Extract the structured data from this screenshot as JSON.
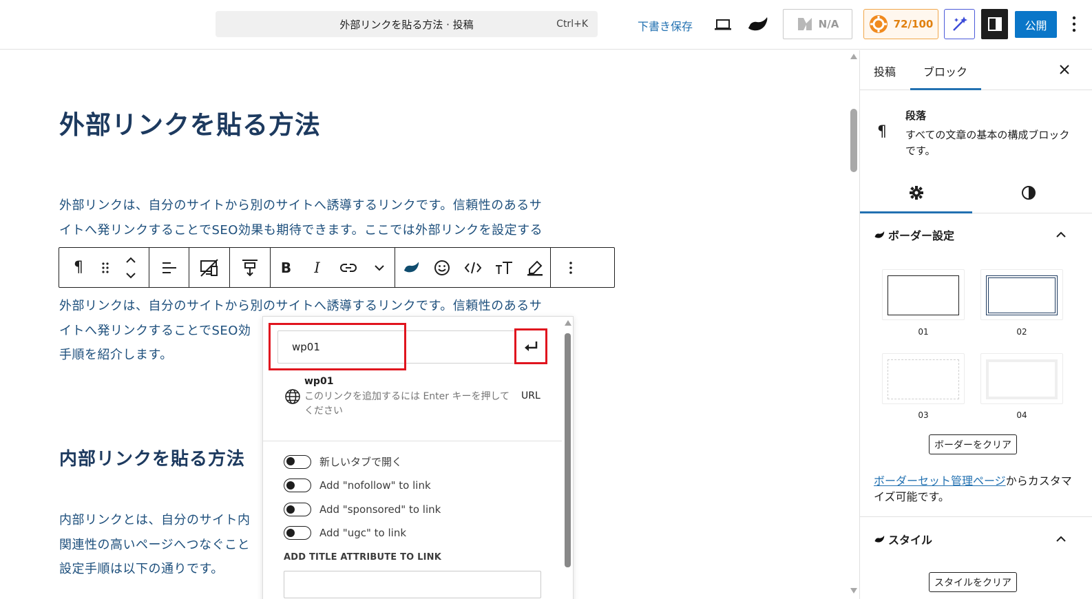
{
  "topbar": {
    "document_title": "外部リンクを貼る方法 · 投稿",
    "shortcut": "Ctrl+K",
    "save_draft": "下書き保存",
    "na_label": "N/A",
    "score": "72/100",
    "publish": "公開",
    "icons": [
      "desktop-preview-icon",
      "swell-logo-icon",
      "seo-check-icon",
      "score-badge-icon",
      "ai-wand-icon",
      "sidebar-toggle-icon",
      "more-options-icon"
    ]
  },
  "editor": {
    "post_title": "外部リンクを貼る方法",
    "para1_line1": "外部リンクは、自分のサイトから別のサイトへ誘導するリンクです。信頼性のあるサ",
    "para1_line2": "イトへ発リンクすることでSEO効果も期待できます。ここでは外部リンクを設定する",
    "para2_line1": "外部リンクは、自分のサイトから別のサイトへ誘導するリンクです。信頼性のあるサ",
    "para2_line2": "イトへ発リンクすることでSEO効",
    "para2_line3": "手順を紹介します。",
    "heading2": "内部リンクを貼る方法",
    "para3_line1": "内部リンクとは、自分のサイト内",
    "para3_line2": "関連性の高いページへつなぐこと",
    "para3_line3": "設定手順は以下の通りです。"
  },
  "block_toolbar": {
    "paragraph_symbol": "¶",
    "tools": [
      "paragraph-icon",
      "drag-handle-icon",
      "move-up-down-icon",
      "align-icon",
      "device-visibility-icon",
      "margin-icon",
      "bold-icon",
      "italic-icon",
      "link-icon",
      "more-formats-icon",
      "swell-format-icon",
      "emoji-icon",
      "code-icon",
      "font-size-icon",
      "highlight-icon",
      "block-options-icon"
    ],
    "bold_label": "B",
    "italic_label": "I"
  },
  "link_popover": {
    "input_value": "wp01",
    "suggestion_title": "wp01",
    "suggestion_desc": "このリンクを追加するには Enter キーを押してください",
    "suggestion_type": "URL",
    "toggles": [
      {
        "label": "新しいタブで開く",
        "checked": false
      },
      {
        "label": "Add \"nofollow\" to link",
        "checked": false
      },
      {
        "label": "Add \"sponsored\" to link",
        "checked": false
      },
      {
        "label": "Add \"ugc\" to link",
        "checked": false
      }
    ],
    "title_attr_label": "ADD TITLE ATTRIBUTE TO LINK",
    "highlight_color": "#e0141e"
  },
  "sidebar": {
    "tab_post": "投稿",
    "tab_block": "ブロック",
    "block_name": "段落",
    "block_desc": "すべての文章の基本の構成ブロックです。",
    "border_section": "ボーダー設定",
    "border_tiles": [
      "01",
      "02",
      "03",
      "04"
    ],
    "clear_border": "ボーダーをクリア",
    "note_link": "ボーダーセット管理ページ",
    "note_text": "からカスタマイズ可能です。",
    "style_section": "スタイル",
    "clear_style": "スタイルをクリア"
  },
  "colors": {
    "accent": "#2271b1",
    "publish": "#0a76c8",
    "heading": "#1d3a5f",
    "body_text": "#1d4f7c",
    "score": "#e0800f"
  }
}
